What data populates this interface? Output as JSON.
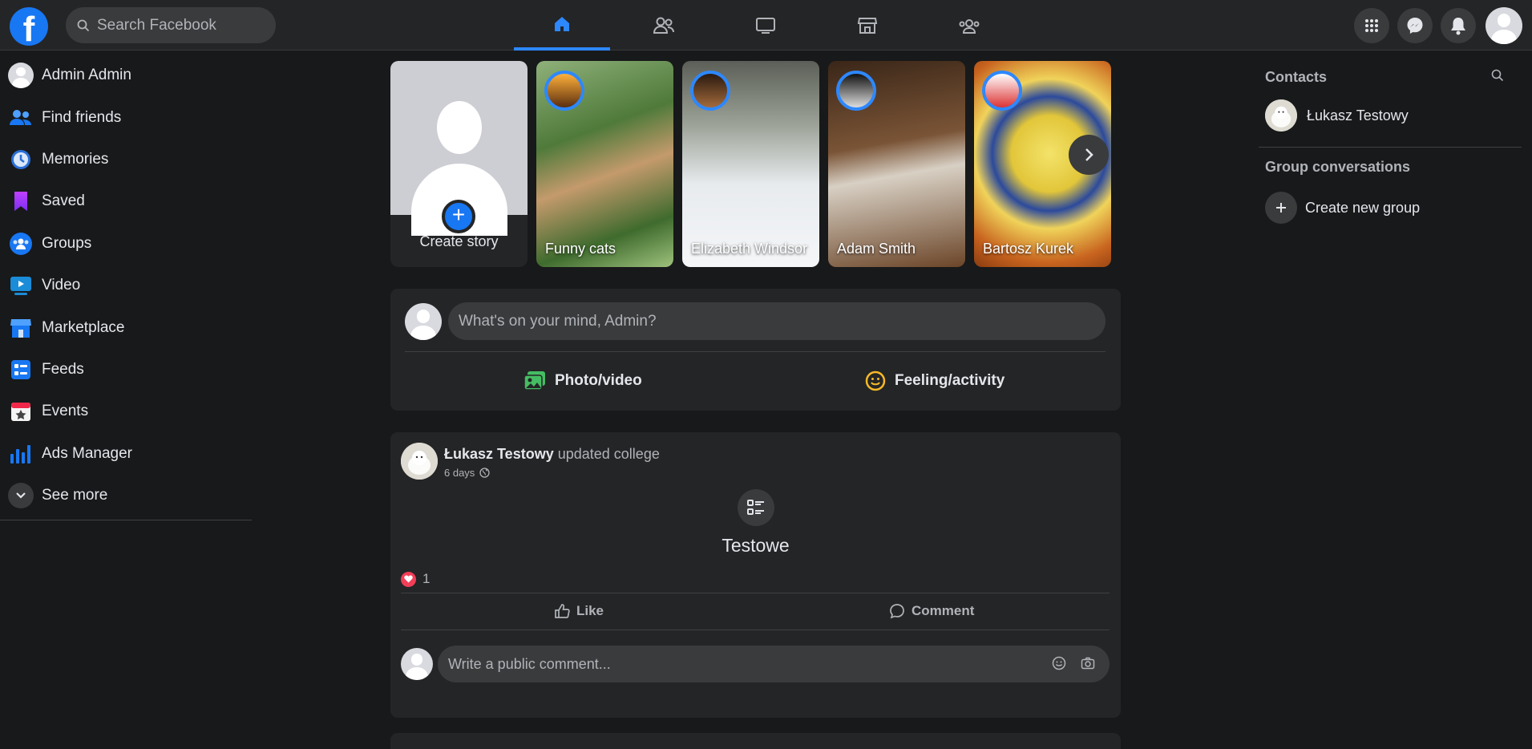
{
  "search": {
    "placeholder": "Search Facebook"
  },
  "top_nav": {
    "tabs": [
      {
        "icon": "home-icon",
        "active": true
      },
      {
        "icon": "friends-icon",
        "active": false
      },
      {
        "icon": "watch-icon",
        "active": false
      },
      {
        "icon": "marketplace-icon",
        "active": false
      },
      {
        "icon": "groups-icon",
        "active": false
      }
    ],
    "right_buttons": [
      "menu-grid-icon",
      "messenger-icon",
      "notifications-icon",
      "account-avatar"
    ]
  },
  "sidebar": {
    "items": [
      {
        "label": "Admin Admin",
        "icon": "profile-avatar"
      },
      {
        "label": "Find friends",
        "icon": "friends-icon"
      },
      {
        "label": "Memories",
        "icon": "memories-clock-icon"
      },
      {
        "label": "Saved",
        "icon": "bookmark-icon"
      },
      {
        "label": "Groups",
        "icon": "groups-icon"
      },
      {
        "label": "Video",
        "icon": "video-icon"
      },
      {
        "label": "Marketplace",
        "icon": "marketplace-icon"
      },
      {
        "label": "Feeds",
        "icon": "feeds-icon"
      },
      {
        "label": "Events",
        "icon": "calendar-star-icon"
      },
      {
        "label": "Ads Manager",
        "icon": "bar-chart-icon"
      },
      {
        "label": "See more",
        "icon": "chevron-down-icon"
      }
    ]
  },
  "stories": {
    "create_label": "Create story",
    "items": [
      {
        "name": "Funny cats"
      },
      {
        "name": "Elizabeth Windsor"
      },
      {
        "name": "Adam Smith"
      },
      {
        "name": "Bartosz Kurek"
      }
    ]
  },
  "composer": {
    "placeholder": "What's on your mind, Admin?",
    "photo_video_label": "Photo/video",
    "feeling_label": "Feeling/activity"
  },
  "post": {
    "author": "Łukasz Testowy",
    "action": "updated college",
    "time": "6 days",
    "life_event_title": "Testowe",
    "reaction_count": "1",
    "like_label": "Like",
    "comment_label": "Comment",
    "comment_placeholder": "Write a public comment..."
  },
  "contacts": {
    "title": "Contacts",
    "items": [
      {
        "name": "Łukasz Testowy"
      }
    ]
  },
  "group_conversations": {
    "title": "Group conversations",
    "create_label": "Create new group"
  },
  "colors": {
    "background": "#18191a",
    "surface": "#242526",
    "input": "#3a3b3c",
    "accent": "#2d88ff",
    "text": "#e4e6eb",
    "muted": "#b0b3b8"
  }
}
